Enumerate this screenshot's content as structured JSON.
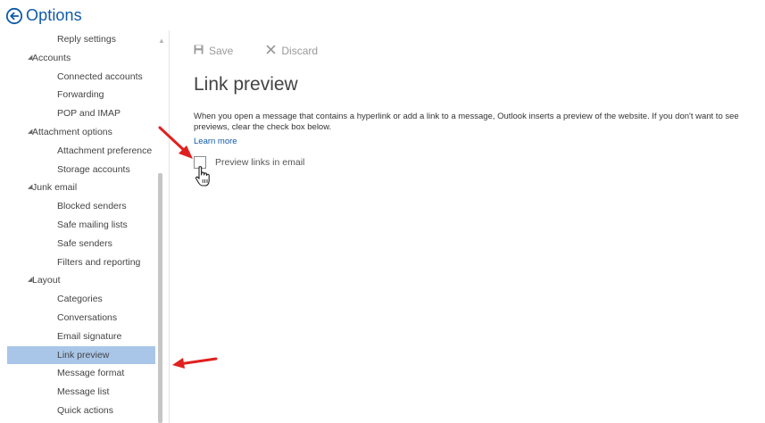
{
  "header": {
    "title": "Options",
    "back_icon": "back-arrow-circle-icon"
  },
  "sidebar": {
    "items": [
      {
        "label": "Reply settings",
        "level": "child"
      },
      {
        "label": "Accounts",
        "level": "group"
      },
      {
        "label": "Connected accounts",
        "level": "child"
      },
      {
        "label": "Forwarding",
        "level": "child"
      },
      {
        "label": "POP and IMAP",
        "level": "child"
      },
      {
        "label": "Attachment options",
        "level": "group"
      },
      {
        "label": "Attachment preference",
        "level": "child"
      },
      {
        "label": "Storage accounts",
        "level": "child"
      },
      {
        "label": "Junk email",
        "level": "group"
      },
      {
        "label": "Blocked senders",
        "level": "child"
      },
      {
        "label": "Safe mailing lists",
        "level": "child"
      },
      {
        "label": "Safe senders",
        "level": "child"
      },
      {
        "label": "Filters and reporting",
        "level": "child"
      },
      {
        "label": "Layout",
        "level": "group"
      },
      {
        "label": "Categories",
        "level": "child"
      },
      {
        "label": "Conversations",
        "level": "child"
      },
      {
        "label": "Email signature",
        "level": "child"
      },
      {
        "label": "Link preview",
        "level": "child",
        "selected": true
      },
      {
        "label": "Message format",
        "level": "child"
      },
      {
        "label": "Message list",
        "level": "child"
      },
      {
        "label": "Quick actions",
        "level": "child"
      }
    ]
  },
  "toolbar": {
    "save_label": "Save",
    "discard_label": "Discard"
  },
  "main": {
    "title": "Link preview",
    "description": "When you open a message that contains a hyperlink or add a link to a message, Outlook inserts a preview of the website. If you don't want to see previews, clear the check box below.",
    "learn_more": "Learn more",
    "checkbox_label": "Preview links in email",
    "checkbox_checked": false
  },
  "colors": {
    "accent": "#0f5aa6",
    "selected_bg": "#a9c6e8",
    "annotation_arrow": "#e02020"
  }
}
